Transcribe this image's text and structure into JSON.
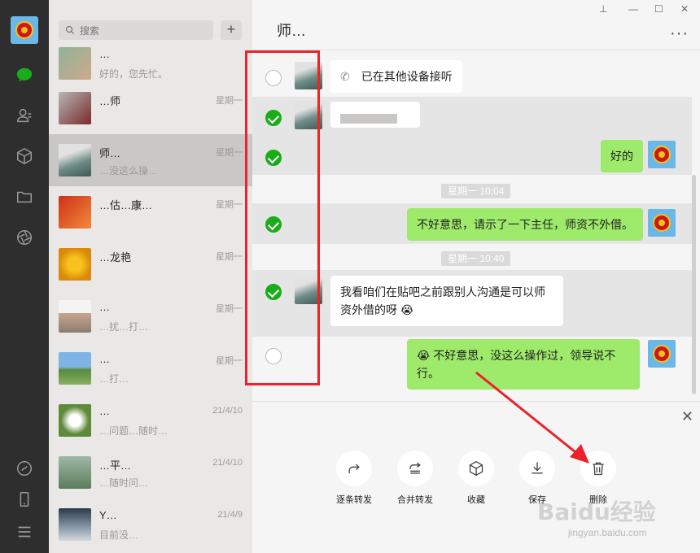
{
  "search": {
    "placeholder": "搜索"
  },
  "conversations": [
    {
      "name": "…",
      "date": "",
      "preview": "好的，您先忙。"
    },
    {
      "name": "…师",
      "date": "星期一",
      "preview": ""
    },
    {
      "name": "师…",
      "date": "星期一",
      "preview": "…没这么操…"
    },
    {
      "name": "…估…康…",
      "date": "星期一",
      "preview": ""
    },
    {
      "name": "…龙艳",
      "date": "星期一",
      "preview": ""
    },
    {
      "name": "…",
      "date": "星期一",
      "preview": "…扰…打…"
    },
    {
      "name": "…",
      "date": "星期一",
      "preview": "…打…"
    },
    {
      "name": "…",
      "date": "21/4/10",
      "preview": "…问题…随时…"
    },
    {
      "name": "…平…",
      "date": "21/4/10",
      "preview": "…随时问…"
    },
    {
      "name": "Y…",
      "date": "21/4/9",
      "preview": "目前没…"
    }
  ],
  "chat": {
    "title": "师…",
    "more": "···",
    "messages": {
      "call": "已在其他设备接听",
      "ok": "好的",
      "sorry1": "不好意思，请示了一下主任，师资不外借。",
      "question": "我看咱们在贴吧之前跟别人沟通是可以师资外借的呀",
      "sorry2": "不好意思，没这么操作过，领导说不行。"
    },
    "times": [
      "星期一 10:04",
      "星期一 10:40"
    ]
  },
  "actions": [
    {
      "label": "逐条转发",
      "icon": "forward-icon"
    },
    {
      "label": "合并转发",
      "icon": "merge-forward-icon"
    },
    {
      "label": "收藏",
      "icon": "favorite-cube-icon"
    },
    {
      "label": "保存",
      "icon": "save-download-icon"
    },
    {
      "label": "删除",
      "icon": "trash-icon"
    }
  ],
  "watermark": {
    "text": "Baidu经验",
    "sub": "jingyan.baidu.com"
  },
  "colors": {
    "accent_green": "#1aad19",
    "bubble_green": "#9eea6a",
    "highlight_red": "#e8232b"
  }
}
